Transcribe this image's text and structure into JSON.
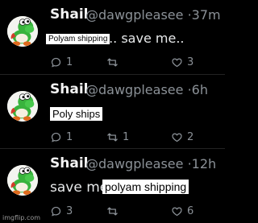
{
  "tweets": [
    {
      "name": "Shail",
      "handle": "@dawgpleasee",
      "time": "37m",
      "pasted_text": "Polyam shipping",
      "text": "... save me..",
      "replies": "1",
      "retweets": "",
      "likes": "3"
    },
    {
      "name": "Shail",
      "handle": "@dawgpleasee",
      "time": "6h",
      "pasted_text": "Poly ships",
      "text": "",
      "replies": "1",
      "retweets": "1",
      "likes": "2"
    },
    {
      "name": "Shail",
      "handle": "@dawgpleasee",
      "time": "12h",
      "text": "save me",
      "pasted_text": "polyam shipping",
      "replies": "3",
      "retweets": "",
      "likes": "6"
    }
  ],
  "separator": "·",
  "icons": [
    "yoshi-avatar-icon",
    "reply-icon",
    "retweet-icon",
    "like-icon"
  ],
  "colors": {
    "background": "#000000",
    "muted": "#8b9197",
    "text": "#e7e9ea",
    "avatar_green": "#38b23c"
  },
  "watermark": "imgflip.com"
}
